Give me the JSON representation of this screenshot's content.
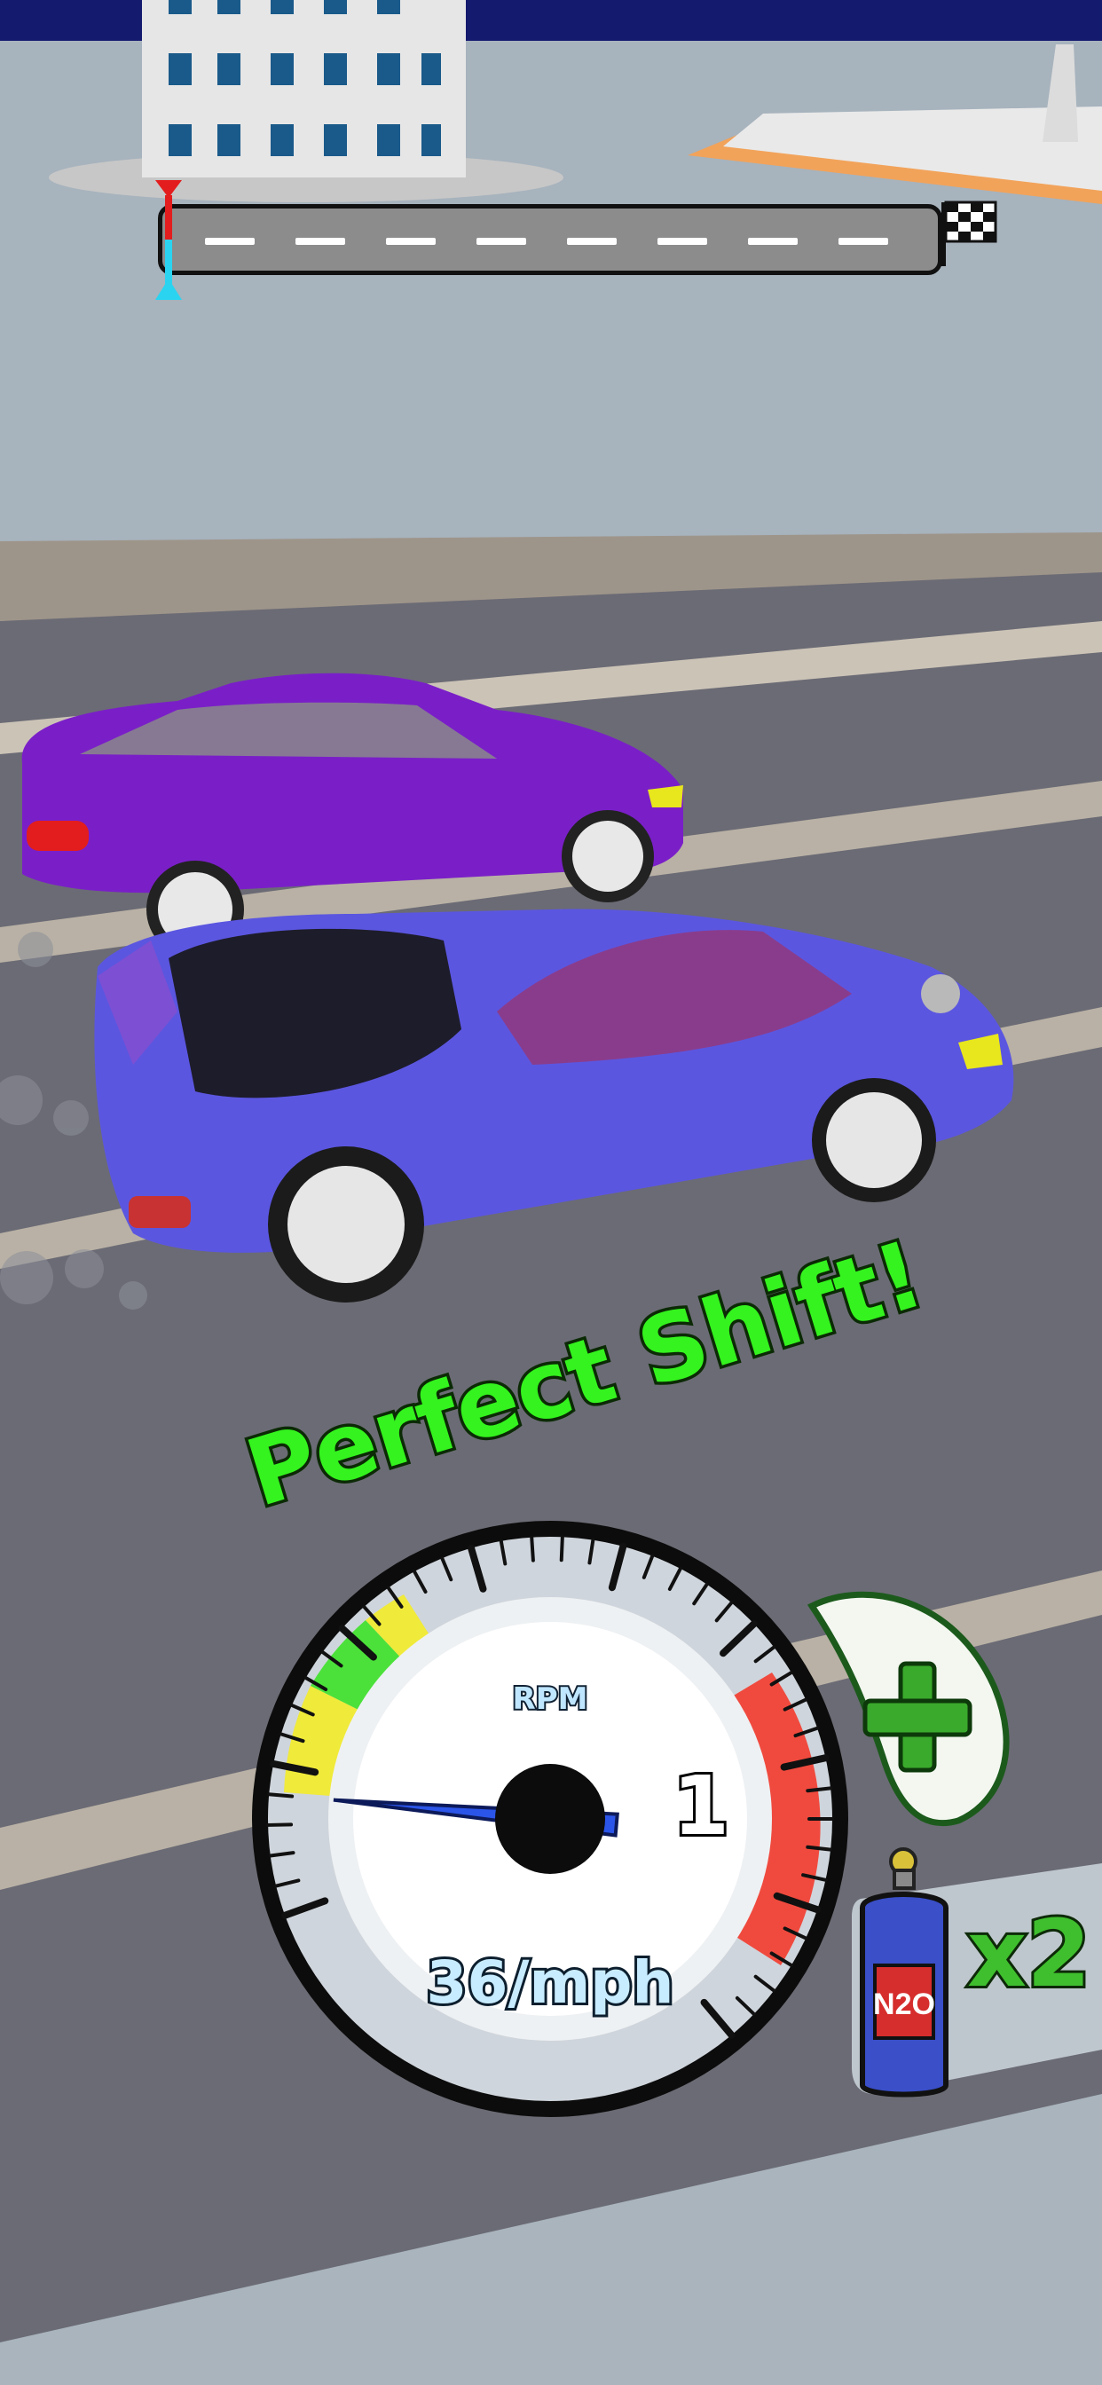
{
  "hud": {
    "progress": {
      "fraction": 0.0,
      "finish_icon": "checkered-flag-icon",
      "marker_icon": "player-position-marker-icon"
    },
    "feedback_text": "Perfect Shift!",
    "tachometer": {
      "label": "RPM",
      "gear": "1",
      "speed_text": "36/mph",
      "needle_level": 0.1
    },
    "upgrade_button": {
      "icon": "plus-icon"
    },
    "nitro": {
      "canister_label": "N2O",
      "count_text": "x2",
      "icon": "nitro-canister-icon"
    }
  },
  "colors": {
    "sky": "#a7b3bd",
    "road": "#6b6b75",
    "player_car": "#5b56e0",
    "opponent_car": "#7a1fc8",
    "feedback_green": "#34f31e",
    "redline": "#f04a3e"
  }
}
